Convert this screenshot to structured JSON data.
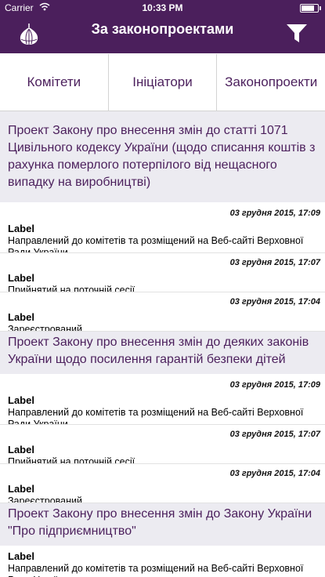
{
  "status_bar": {
    "carrier": "Carrier",
    "time": "10:33 PM",
    "battery_level": 0.9
  },
  "nav": {
    "title": "За законопроектами",
    "logo_icon": "onion-dome-icon",
    "filter_icon": "filter-icon"
  },
  "tabs": [
    {
      "label": "Комітети"
    },
    {
      "label": "Ініціатори"
    },
    {
      "label": "Законопроекти"
    }
  ],
  "bills": [
    {
      "title": "Проект Закону про внесення змін до статті 1071 Цивільного кодексу України (щодо списання коштів з рахунка померлого потерпілого від нещасного випадку на виробництві)",
      "events": [
        {
          "date": "03 грудня 2015, 17:09",
          "label": "Label",
          "status": "Направлений до комітетів та розміщений на Веб-сайті Верховної Ради України"
        },
        {
          "date": "03 грудня 2015, 17:07",
          "label": "Label",
          "status": "Прийнятий на поточній сесії"
        },
        {
          "date": "03 грудня 2015, 17:04",
          "label": "Label",
          "status": "Зареєстрований"
        }
      ]
    },
    {
      "title": "Проект Закону про внесення змін до деяких законів України щодо посилення гарантій безпеки дітей",
      "events": [
        {
          "date": "03 грудня 2015, 17:09",
          "label": "Label",
          "status": "Направлений до комітетів та розміщений на Веб-сайті Верховної Ради України"
        },
        {
          "date": "03 грудня 2015, 17:07",
          "label": "Label",
          "status": "Прийнятий на поточній сесії"
        },
        {
          "date": "03 грудня 2015, 17:04",
          "label": "Label",
          "status": "Зареєстрований"
        }
      ]
    },
    {
      "title": "Проект Закону про внесення змін до Закону України \"Про підприємництво\"",
      "events": [
        {
          "date": "",
          "label": "Label",
          "status": "Направлений до комітетів та розміщений на Веб-сайті Верховної Ради України"
        }
      ]
    }
  ]
}
